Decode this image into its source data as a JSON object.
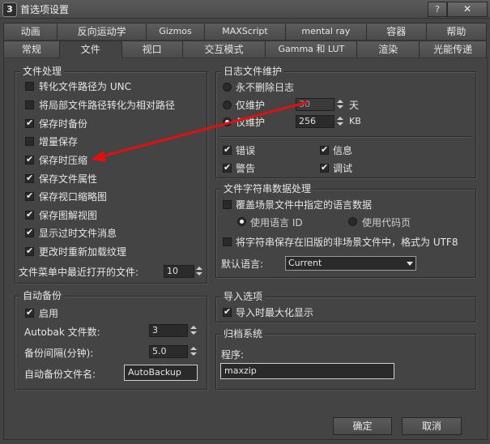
{
  "window": {
    "title": "首选项设置",
    "app_icon": "3ds-max-icon",
    "help_button": "?",
    "close_button": "✕"
  },
  "tabs_row1": [
    "动画",
    "反向运动学",
    "Gizmos",
    "MAXScript",
    "mental ray",
    "容器",
    "帮助"
  ],
  "tabs_row2": [
    "常规",
    "文件",
    "视口",
    "交互模式",
    "Gamma 和 LUT",
    "渲染",
    "光能传递"
  ],
  "active_tab": "文件",
  "file_handling": {
    "title": "文件处理",
    "options": [
      {
        "label": "转化文件路径为 UNC",
        "checked": false
      },
      {
        "label": "将局部文件路径转化为相对路径",
        "checked": false
      },
      {
        "label": "保存时备份",
        "checked": true
      },
      {
        "label": "增量保存",
        "checked": false
      },
      {
        "label": "保存时压缩",
        "checked": true
      },
      {
        "label": "保存文件属性",
        "checked": true
      },
      {
        "label": "保存视口缩略图",
        "checked": true
      },
      {
        "label": "保存图解视图",
        "checked": true
      },
      {
        "label": "显示过时文件消息",
        "checked": true
      },
      {
        "label": "更改时重新加载纹理",
        "checked": true
      }
    ],
    "recent_files_label": "文件菜单中最近打开的文件:",
    "recent_files_value": "10"
  },
  "log_maintenance": {
    "title": "日志文件维护",
    "never_delete": "永不删除日志",
    "keep_days_label": "仅维护",
    "keep_days_value": "30",
    "keep_days_unit": "天",
    "keep_kb_label": "仅维护",
    "keep_kb_value": "256",
    "keep_kb_unit": "KB",
    "selected": "kb",
    "levels": [
      {
        "label": "错误",
        "checked": true
      },
      {
        "label": "信息",
        "checked": true
      },
      {
        "label": "警告",
        "checked": true
      },
      {
        "label": "调试",
        "checked": true
      }
    ]
  },
  "string_data": {
    "title": "文件字符串数据处理",
    "override_label": "覆盖场景文件中指定的语言数据",
    "override_checked": false,
    "use_language_id": "使用语言 ID",
    "use_code_page": "使用代码页",
    "save_legacy_label": "将字符串保存在旧版的非场景文件中，格式为 UTF8",
    "save_legacy_checked": false,
    "default_language_label": "默认语言:",
    "default_language_value": "Current"
  },
  "auto_backup": {
    "title": "自动备份",
    "enable_label": "启用",
    "enabled": true,
    "count_label": "Autobak 文件数:",
    "count_value": "3",
    "interval_label": "备份间隔(分钟):",
    "interval_value": "5.0",
    "name_label": "自动备份文件名:",
    "name_value": "AutoBackup"
  },
  "import_options": {
    "title": "导入选项",
    "maximize_label": "导入时最大化显示",
    "maximize_checked": true
  },
  "archive": {
    "title": "归档系统",
    "program_label": "程序:",
    "program_value": "maxzip"
  },
  "footer": {
    "ok": "确定",
    "cancel": "取消"
  },
  "annotation": {
    "color": "#e01010"
  }
}
